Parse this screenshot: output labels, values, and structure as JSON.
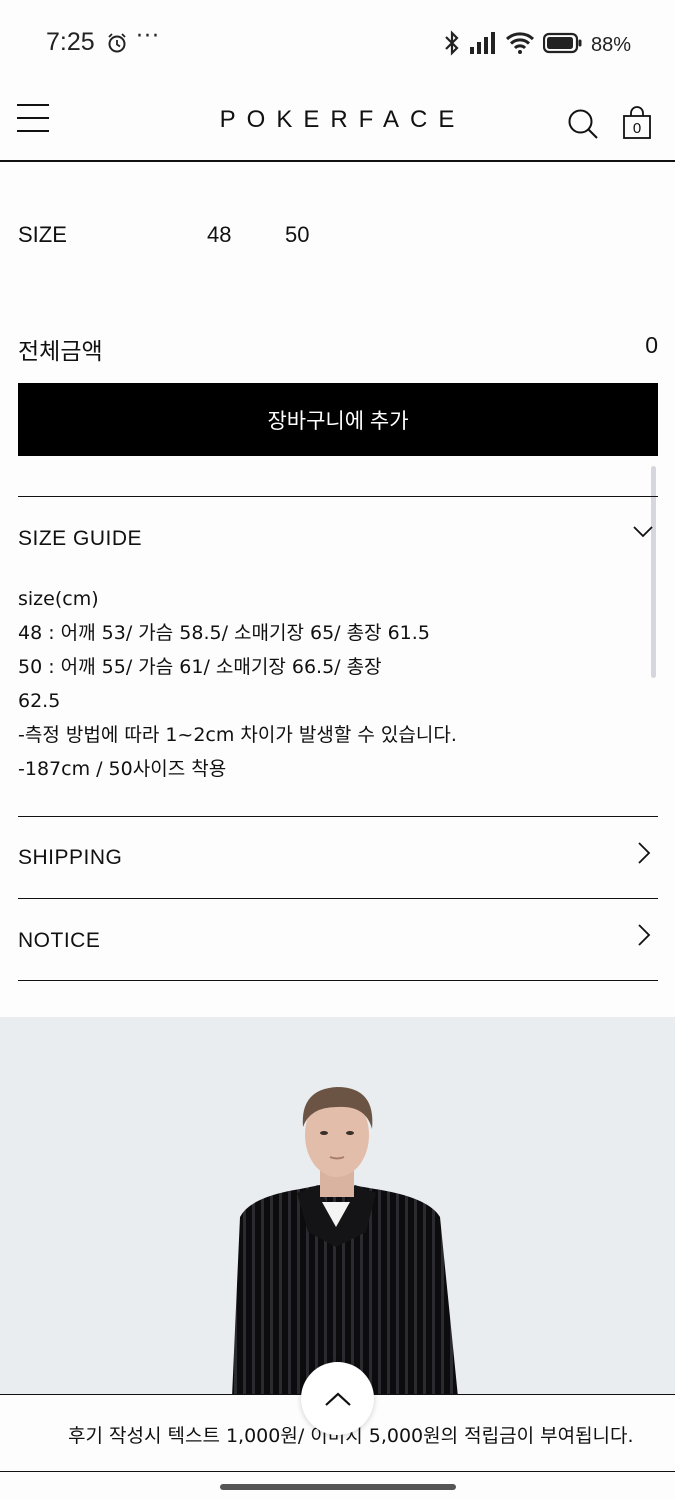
{
  "status_bar": {
    "time": "7:25",
    "more": "···",
    "battery": "88%",
    "icons": [
      "alarm-icon",
      "bluetooth-icon",
      "signal-icon",
      "wifi-icon",
      "battery-icon"
    ]
  },
  "header": {
    "logo": "POKERFACE",
    "cart_count": "0"
  },
  "size": {
    "label": "SIZE",
    "options": [
      "48",
      "50"
    ]
  },
  "total": {
    "label": "전체금액",
    "value": "0"
  },
  "cart_button": "장바구니에 추가",
  "accordion": {
    "size_guide": {
      "title": "SIZE GUIDE",
      "lines": [
        "size(cm)",
        "48 : 어깨 53/ 가슴 58.5/ 소매기장 65/ 총장 61.5",
        "50 : 어깨 55/ 가슴 61/ 소매기장 66.5/ 총장",
        "62.5",
        "-측정 방법에 따라 1~2cm 차이가 발생할 수 있습니다.",
        "-187cm / 50사이즈 착용"
      ]
    },
    "shipping": {
      "title": "SHIPPING"
    },
    "notice": {
      "title": "NOTICE"
    }
  },
  "bottom_banner": "후기 작성시 텍스트 1,000원/ 이미지 5,000원의 적립금이 부여됩니다.",
  "colors": {
    "accent": "#000000",
    "background": "#fdfdfd",
    "image_bg": "#e9edef"
  }
}
